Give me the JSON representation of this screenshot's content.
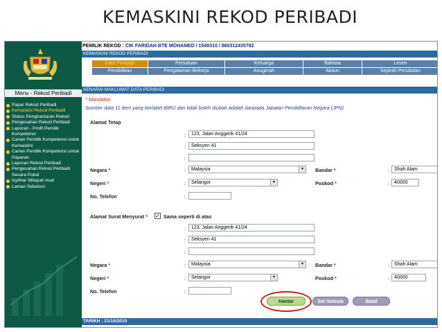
{
  "slide": {
    "title": "KEMASKINI REKOD PERIBADI"
  },
  "sidebar": {
    "menu_heading": "Menu - Rekod Peribadi",
    "items": [
      {
        "label": "Papar Rekod Peribadi",
        "active": false
      },
      {
        "label": "Kemaskini Rekod Peribadi",
        "active": true
      },
      {
        "label": "Status Penghantaran Rekod",
        "active": false
      },
      {
        "label": "Pengesahan Rekod Peribadi",
        "active": false
      },
      {
        "label": "Laporan - Profil Pemilik Kompetensi",
        "active": false
      },
      {
        "label": "Carian Pemilik Kompetensi untuk Kemaskini",
        "active": false
      },
      {
        "label": "Carian Pemilik Kompetensi untuk Paparan",
        "active": false
      },
      {
        "label": "Laporan Rekod Peribadi",
        "active": false
      },
      {
        "label": "Pengesahan Rekod Peribadi Secara Pukal",
        "active": false
      },
      {
        "label": "Isytihar Wilayah Asal",
        "active": false
      },
      {
        "label": "Laman Sebelum",
        "active": false
      }
    ]
  },
  "header": {
    "owner_label": "PEMILIK REKOD :",
    "owner_value": "CIK FARIDAH BTE MOHAMED / 1549310 / 860312435792",
    "section_title": "KEMASKINI REKOD PERIBADI"
  },
  "tabs_row1": [
    "Data Peribadi",
    "Persatuan",
    "Keluarga",
    "Bahasa",
    "Lesen"
  ],
  "tabs_row2": [
    "Pendidikan",
    "Pengalaman Bekerja",
    "Anugerah",
    "Akaun",
    "Sejarah Perubatan"
  ],
  "list_title": "SENARAI MAKLUMAT DATA PERIBADI",
  "mandatori": "* Mandatori",
  "note": "Sumber data 11 item yang berlabel BIRU dan tidak boleh diubah adalah daripada Jabatan Pendaftaran Negara (JPN)",
  "alamat_tetap": {
    "heading": "Alamat Tetap",
    "line1": "123, Jalan Anggerik 41/24",
    "line2": "Seksyen 41",
    "line3": "",
    "negara_label": "Negara",
    "negara": "Malaysia",
    "bandar_label": "Bandar",
    "bandar": "Shah Alam",
    "negeri_label": "Negeri",
    "negeri": "Selangor",
    "poskod_label": "Poskod",
    "poskod": "40000",
    "telefon_label": "No. Telefon",
    "telefon": ""
  },
  "alamat_surat": {
    "heading": "Alamat Surat Menyurat",
    "same_label": "Sama seperti di atas",
    "same_checked": true,
    "line1": "123, Jalan Anggerik 41/24",
    "line2": "Seksyen 41",
    "line3": "",
    "negara_label": "Negara",
    "negara": "Malaysia",
    "bandar_label": "Bandar",
    "bandar": "Shah Alam",
    "negeri_label": "Negeri",
    "negeri": "Selangor",
    "poskod_label": "Poskod",
    "poskod": "40000",
    "telefon_label": "No. Telefon",
    "telefon": ""
  },
  "buttons": {
    "submit": "Hantar",
    "reset": "Set Semula",
    "cancel": "Batal"
  },
  "footer": {
    "date": "TARIKH : 21/10/2010"
  },
  "colors": {
    "sidebar": "#0c5a45",
    "bar": "#2e6aa2",
    "tab": "#5d7fa6",
    "tab_active": "#cc8c16",
    "highlight": "#cc1a1a"
  },
  "symbols": {
    "colon": ":",
    "required": "*",
    "check": "✓",
    "arrow": "▾"
  }
}
